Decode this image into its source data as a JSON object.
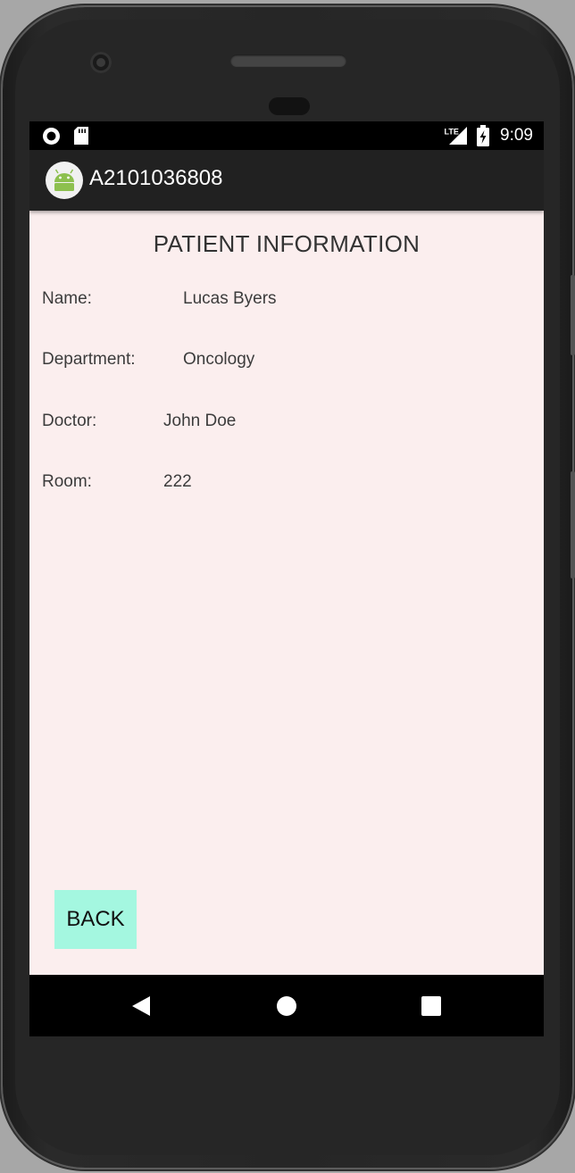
{
  "status_bar": {
    "network": "LTE",
    "time": "9:09"
  },
  "app_bar": {
    "title": "A2101036808",
    "icon": "android-icon"
  },
  "page": {
    "heading": "PATIENT INFORMATION",
    "fields": {
      "name": {
        "label": "Name:",
        "value": "Lucas Byers"
      },
      "department": {
        "label": "Department:",
        "value": "Oncology"
      },
      "doctor": {
        "label": "Doctor:",
        "value": "John Doe"
      },
      "room": {
        "label": "Room:",
        "value": "222"
      }
    },
    "back_button": "BACK"
  },
  "nav_bar": {
    "icons": [
      "back-triangle-icon",
      "home-circle-icon",
      "recents-square-icon"
    ]
  },
  "colors": {
    "screen_background": "#fbeeee",
    "app_bar": "#212121",
    "status_bar": "#000000",
    "back_button": "#a4f7e0"
  }
}
